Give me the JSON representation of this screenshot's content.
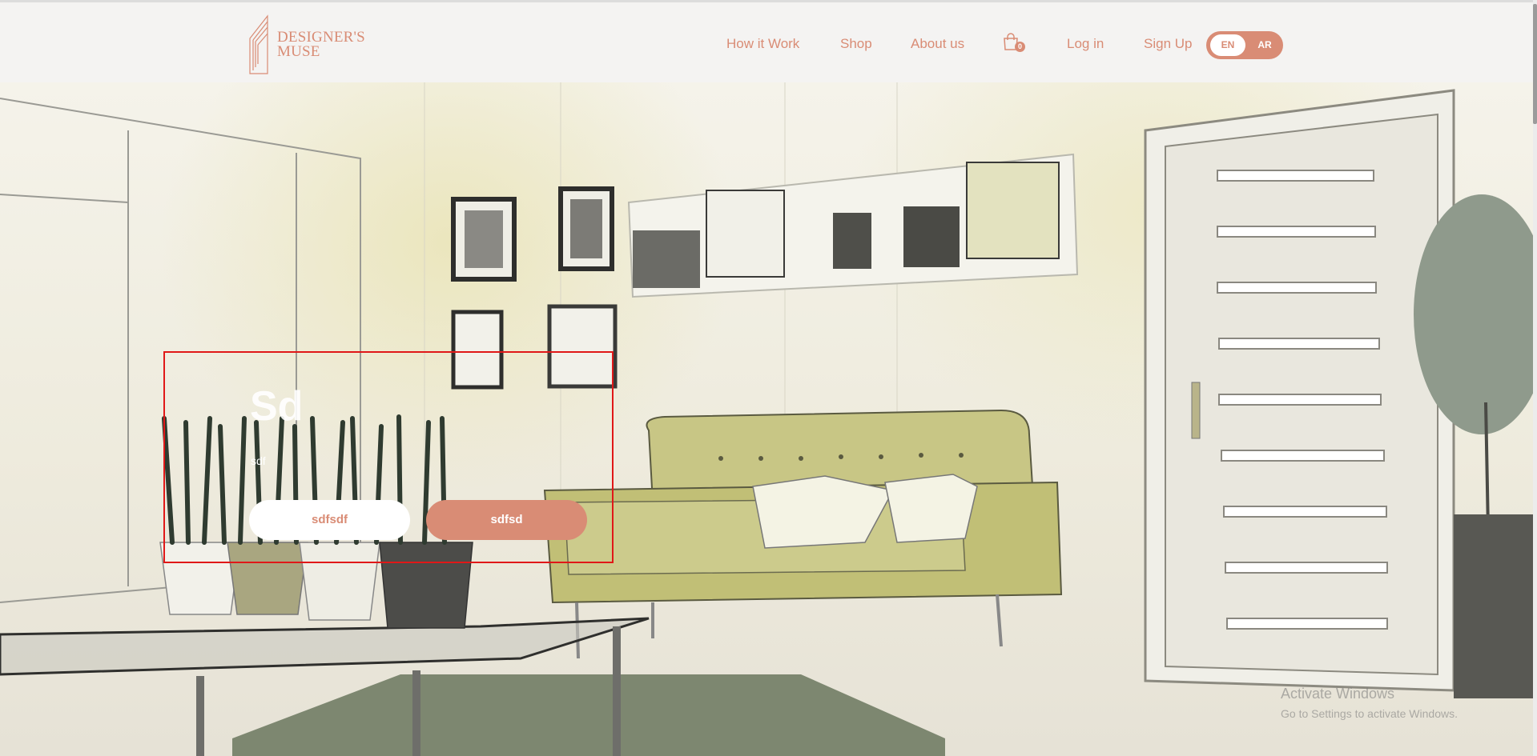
{
  "brand": {
    "name_line1": "DESIGNER'S",
    "name_line2": "MUSE"
  },
  "nav": {
    "links": [
      "How it Work",
      "Shop",
      "About us",
      "Log in",
      "Sign Up"
    ],
    "cart_count": "0",
    "lang": {
      "en": "EN",
      "ar": "AR",
      "active": "EN"
    }
  },
  "hero": {
    "title": "Sd",
    "subtitle": "sdf",
    "buttons": {
      "primary": "sdfsdf",
      "secondary": "sdfsd"
    }
  },
  "watermark": {
    "line1": "Activate Windows",
    "line2": "Go to Settings to activate Windows."
  },
  "colors": {
    "accent": "#d98c75",
    "navbar_bg": "#f4f3f2",
    "highlight": "#e01818",
    "sofa": "#c3c27a"
  }
}
